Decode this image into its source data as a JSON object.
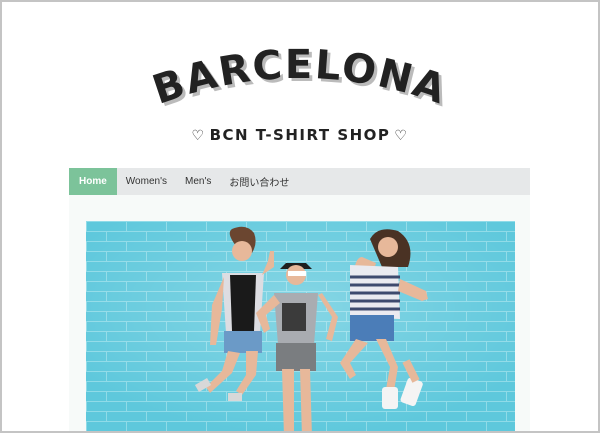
{
  "site": {
    "logo_text": "BARCELONA",
    "tagline": "BCN T-SHIRT SHOP",
    "heart_glyph": "♡"
  },
  "nav": {
    "items": [
      {
        "label": "Home",
        "active": true
      },
      {
        "label": "Women's",
        "active": false
      },
      {
        "label": "Men's",
        "active": false
      },
      {
        "label": "お問い合わせ",
        "active": false
      }
    ]
  },
  "hero": {
    "wall_color": "#5ec8dc",
    "accent_color": "#7cc39a"
  }
}
